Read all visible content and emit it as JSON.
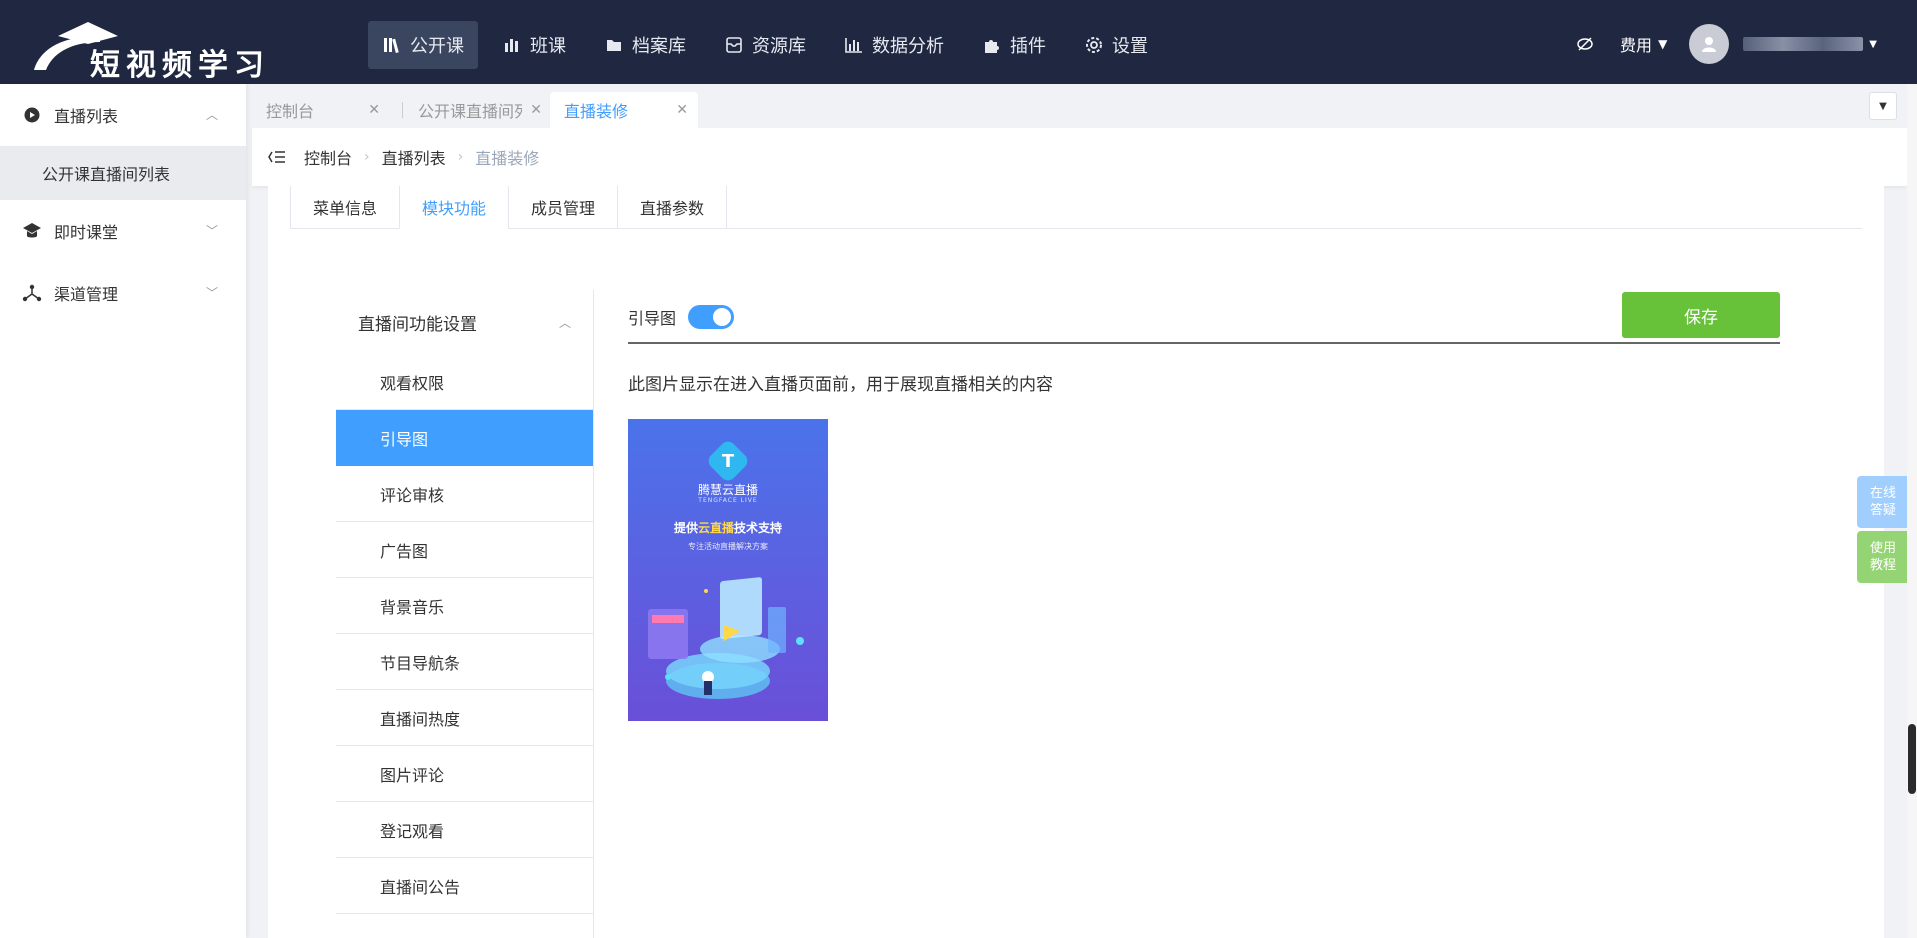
{
  "header": {
    "logo_text": "短视频学习",
    "nav": [
      {
        "label": "公开课",
        "icon": "bookshelf-icon",
        "active": true
      },
      {
        "label": "班课",
        "icon": "bar-chart-building-icon",
        "active": false
      },
      {
        "label": "档案库",
        "icon": "folder-icon",
        "active": false
      },
      {
        "label": "资源库",
        "icon": "archive-box-icon",
        "active": false
      },
      {
        "label": "数据分析",
        "icon": "bar-chart-icon",
        "active": false
      },
      {
        "label": "插件",
        "icon": "puzzle-icon",
        "active": false
      },
      {
        "label": "设置",
        "icon": "gear-icon",
        "active": false
      }
    ],
    "fee_label": "费用",
    "avatar_icon": "user-icon",
    "username": ""
  },
  "sidebar": {
    "items": [
      {
        "label": "直播列表",
        "icon": "chat-bubble-icon",
        "expanded": true,
        "children": [
          {
            "label": "公开课直播间列表"
          }
        ]
      },
      {
        "label": "即时课堂",
        "icon": "graduation-cap-icon",
        "expanded": false
      },
      {
        "label": "渠道管理",
        "icon": "share-nodes-icon",
        "expanded": false
      }
    ]
  },
  "tabs": [
    {
      "label": "控制台",
      "active": false
    },
    {
      "label": "公开课直播间列",
      "active": false
    },
    {
      "label": "直播装修",
      "active": true
    }
  ],
  "breadcrumb": {
    "items": [
      "控制台",
      "直播列表",
      "直播装修"
    ]
  },
  "subtabs": [
    {
      "label": "菜单信息",
      "active": false
    },
    {
      "label": "模块功能",
      "active": true
    },
    {
      "label": "成员管理",
      "active": false
    },
    {
      "label": "直播参数",
      "active": false
    }
  ],
  "menu": {
    "head": "直播间功能设置",
    "items": [
      {
        "label": "观看权限",
        "active": false
      },
      {
        "label": "引导图",
        "active": true
      },
      {
        "label": "评论审核",
        "active": false
      },
      {
        "label": "广告图",
        "active": false
      },
      {
        "label": "背景音乐",
        "active": false
      },
      {
        "label": "节目导航条",
        "active": false
      },
      {
        "label": "直播间热度",
        "active": false
      },
      {
        "label": "图片评论",
        "active": false
      },
      {
        "label": "登记观看",
        "active": false
      },
      {
        "label": "直播间公告",
        "active": false
      }
    ]
  },
  "content": {
    "toggle_label": "引导图",
    "toggle_on": true,
    "save_label": "保存",
    "description": "此图片显示在进入直播页面前，用于展现直播相关的内容",
    "poster": {
      "brand_cn": "腾慧云直播",
      "brand_en": "TENGFACE LIVE",
      "slogan_a": "提供",
      "slogan_highlight": "云直播",
      "slogan_b": "技术支持",
      "sub": "专注活动直播解决方案"
    }
  },
  "float": {
    "qa": "在线答疑",
    "tutorial": "使用教程"
  },
  "colors": {
    "topbar": "#1f2741",
    "primary": "#409eff",
    "save": "#67c23a",
    "float_qa": "#a0cfff",
    "float_tutorial": "#95d475"
  }
}
